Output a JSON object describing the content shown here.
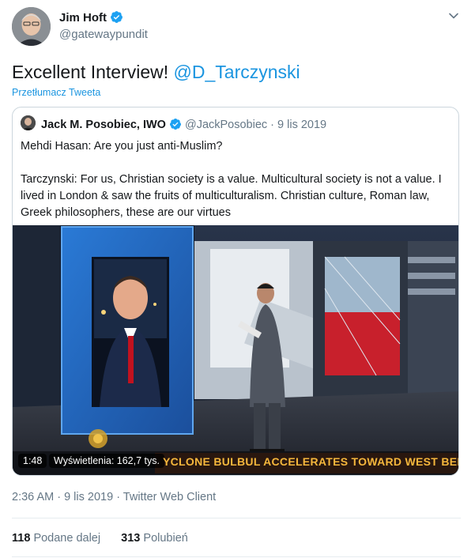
{
  "tweet": {
    "author_name": "Jim Hoft",
    "author_handle": "@gatewaypundit",
    "text_prefix": "Excellent Interview! ",
    "mention": "@D_Tarczynski",
    "translate_label": "Przetłumacz Tweeta"
  },
  "quoted_tweet": {
    "author_name": "Jack M. Posobiec, IWO",
    "author_handle": "@JackPosobiec",
    "separator": " · ",
    "date": "9 lis 2019",
    "line1": "Mehdi Hasan: Are you just anti-Muslim?",
    "line2": "Tarczynski: For us, Christian society is a value. Multicultural society is not a value. I lived in London & saw the fruits of multiculturalism. Christian culture, Roman law, Greek philosophers, these are our virtues",
    "video": {
      "duration": "1:48",
      "views": "Wyświetlenia: 162,7 tys.",
      "ticker": "YCLONE BULBUL ACCELERATES TOWARD WEST BENGAL AND"
    }
  },
  "meta": {
    "time": "2:36 AM",
    "dot": " · ",
    "date": "9 lis 2019",
    "client": "Twitter Web Client"
  },
  "stats": {
    "retweets_count": "118",
    "retweets_label": "Podane dalej",
    "likes_count": "313",
    "likes_label": "Polubień"
  },
  "icons": {
    "verified": "verified-badge-icon",
    "caret": "chevron-down-icon"
  },
  "colors": {
    "accent": "#1b95e0",
    "muted": "#657786",
    "text": "#14171a",
    "border": "#ccd6dd",
    "ticker": "#f6b73c"
  }
}
